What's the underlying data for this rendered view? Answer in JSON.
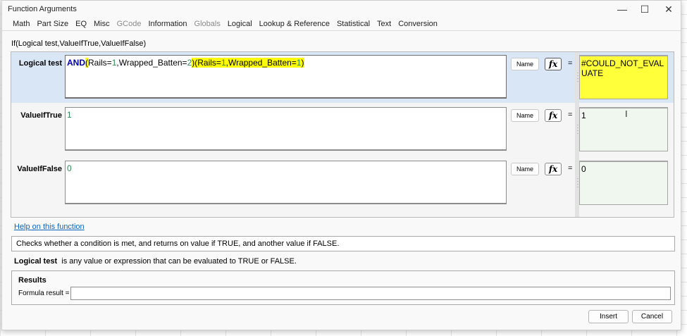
{
  "window": {
    "title": "Function Arguments",
    "minimize_icon": "minimize-icon",
    "maximize_icon": "maximize-icon",
    "close_icon": "close-icon",
    "minimize_glyph": "—",
    "maximize_glyph": "☐",
    "close_glyph": "✕"
  },
  "tabs": [
    "Math",
    "Part Size",
    "EQ",
    "Misc",
    "GCode",
    "Information",
    "Globals",
    "Logical",
    "Lookup & Reference",
    "Statistical",
    "Text",
    "Conversion"
  ],
  "signature": "If(Logical test,ValueIfTrue,ValueIfFalse)",
  "arguments": [
    {
      "label": "Logical test",
      "value": "AND(Rails=1,Wrapped_Batten=2)(Rails=1,Wrapped_Batten=1)",
      "result": "#COULD_NOT_EVALUATE",
      "result_highlighted": true
    },
    {
      "label": "ValueIfTrue",
      "value": "1",
      "result": "1"
    },
    {
      "label": "ValueIfFalse",
      "value": "0",
      "result": "0"
    }
  ],
  "expression_tokens": {
    "kw": "AND",
    "p1": "(",
    "a1": "Rails=",
    "n1": "1",
    "a2": ",Wrapped_Batten=",
    "n2": "2",
    "p2": ")",
    "p3": "(",
    "a3": "Rails=",
    "n3": "1",
    "a4": ",Wrapped_Batten=",
    "n4": "1",
    "p4": ")"
  },
  "name_button_label": "Name",
  "fx_label": "fx",
  "equals": "=",
  "help_link": "Help on this function",
  "description": "Checks whether a condition is met, and returns on value if TRUE, and another value if FALSE.",
  "argument_description": {
    "name": "Logical test",
    "text": "is any value or expression that can be evaluated to TRUE or FALSE."
  },
  "results": {
    "heading": "Results",
    "formula_label": "Formula result =",
    "formula_value": ""
  },
  "buttons": {
    "insert": "Insert",
    "cancel": "Cancel"
  },
  "colors": {
    "highlight": "#ffff00",
    "keyword": "#0000a8",
    "number": "#2e8b57",
    "selected_row": "#d8e6f6",
    "link": "#0b64c0"
  }
}
